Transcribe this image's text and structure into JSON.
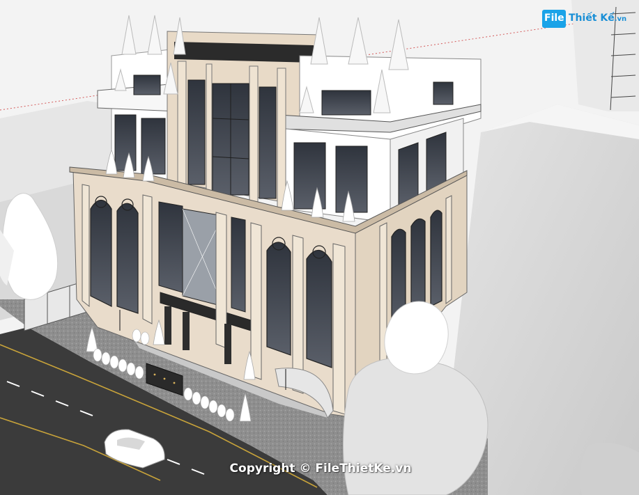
{
  "image": {
    "description_free": true
  },
  "logo": {
    "badge": "File",
    "name": "Thiết Kế",
    "suffix": ".vn",
    "color": "#1aa3e8"
  },
  "watermark": {
    "text": "Copyright © FileThietKe.vn"
  },
  "palette": {
    "sky": "#f4f4f4",
    "ground": "#9a9a9a",
    "road": "#3a3a3a",
    "facade": "#e9dccb",
    "white_wall": "#ffffff",
    "glass": "#4a4f5a",
    "gray_block": "#d6d6d6"
  }
}
